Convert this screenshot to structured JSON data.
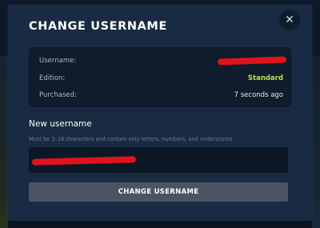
{
  "modal": {
    "title": "CHANGE USERNAME",
    "close_icon": "close-icon"
  },
  "info": {
    "rows": [
      {
        "label": "Username:",
        "value": "",
        "redacted": true
      },
      {
        "label": "Edition:",
        "value": "Standard"
      },
      {
        "label": "Purchased:",
        "value": "7 seconds ago"
      }
    ]
  },
  "form": {
    "label": "New username",
    "hint": "Must be 3–16 characters and contain only letters, numbers, and underscores.",
    "input_value": "",
    "input_redacted": true,
    "submit_label": "CHANGE USERNAME"
  },
  "colors": {
    "modal_bg": "#182b42",
    "card_bg": "#0f1c2c",
    "accent": "#b8e04a",
    "redaction": "#e0131c",
    "button_bg": "#4a5563"
  }
}
